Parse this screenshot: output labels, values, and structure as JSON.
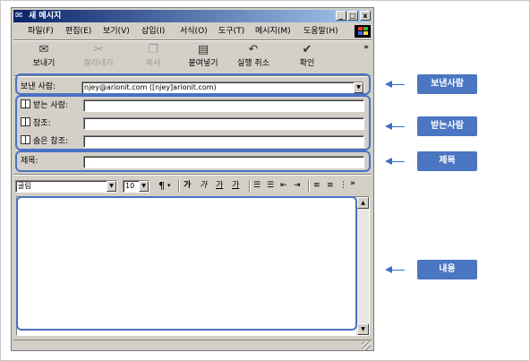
{
  "window": {
    "title": "새 메시지",
    "buttons": {
      "minimize": "_",
      "maximize": "□",
      "close": "x"
    }
  },
  "menu": {
    "items": [
      "파일(F)",
      "편집(E)",
      "보기(V)",
      "삽입(I)",
      "서식(O)",
      "도구(T)",
      "메시지(M)",
      "도움말(H)"
    ]
  },
  "toolbar": {
    "send": "보내기",
    "cut": "잘라내기",
    "copy": "복사",
    "paste": "붙여넣기",
    "undo": "실행 취소",
    "check": "확인",
    "more": "»"
  },
  "fields": {
    "from_label": "보낸 사람:",
    "from_value": "njey@arionit.com     ([njey]arionit.com)",
    "to_label": "받는 사람:",
    "to_value": "",
    "cc_label": "참조:",
    "cc_value": "",
    "bcc_label": "숨은 참조:",
    "bcc_value": "",
    "subject_label": "제목:",
    "subject_value": ""
  },
  "format": {
    "font": "굴림",
    "size": "10",
    "bold": "가",
    "italic": "가",
    "underline": "가",
    "color": "가",
    "more": "»"
  },
  "callouts": {
    "sender": "보낸사람",
    "recipient": "받는사람",
    "subject": "제목",
    "content": "내용"
  },
  "colors": {
    "highlight": "#4a72c4",
    "callout_bg": "#4a76c2",
    "titlebar_start": "#0a246a",
    "titlebar_end": "#a6caf0",
    "window_bg": "#d4d0c8"
  }
}
